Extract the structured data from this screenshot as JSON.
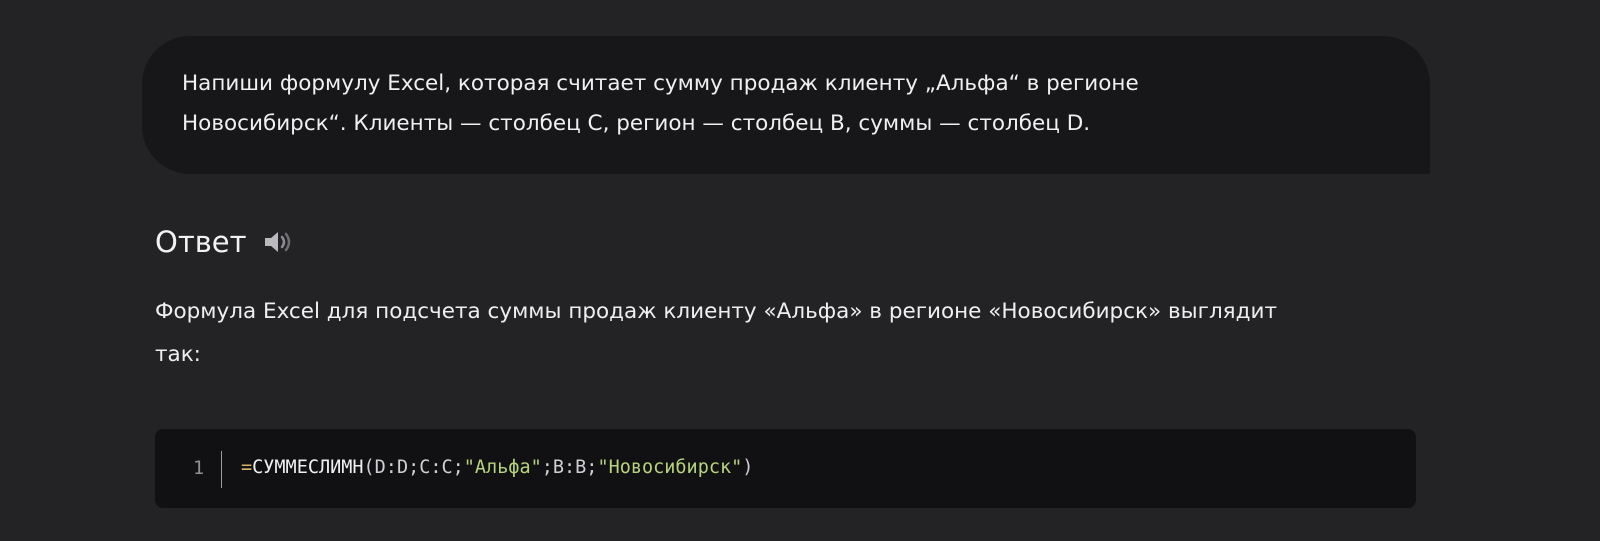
{
  "user_message": {
    "line1": "Напиши формулу Excel, которая считает сумму продаж клиенту „Альфа“ в регионе",
    "line2": "Новосибирск“. Клиенты — столбец С, регион — столбец В, суммы — столбец D."
  },
  "answer": {
    "heading": "Ответ",
    "speaker_icon": "speaker-icon",
    "text_line1": "Формула Excel для подсчета суммы продаж клиенту «Альфа» в регионе «Новосибирск» выглядит",
    "text_line2": "так:"
  },
  "code_block": {
    "line_number": "1",
    "tokens": {
      "equals": "=",
      "function": "СУММЕСЛИМН",
      "open_paren": "(",
      "arg1": "D:D;C:C;",
      "string1": "\"Альфа\"",
      "arg2": ";B:B;",
      "string2": "\"Новосибирск\"",
      "close_paren": ")"
    }
  },
  "colors": {
    "background": "#232326",
    "user_bubble": "#17171a",
    "code_background": "#111113",
    "string_accent": "#b6d37c",
    "operator_accent": "#d7b46a"
  }
}
